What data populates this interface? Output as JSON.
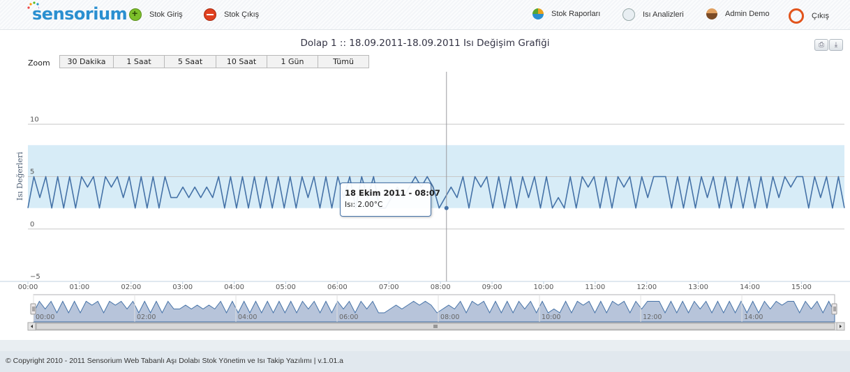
{
  "app": {
    "logo": "sensorium"
  },
  "nav": {
    "stock_in": "Stok Giriş",
    "stock_out": "Stok Çıkış",
    "stock_reports": "Stok Raporları",
    "heat_analysis": "Isı Analizleri",
    "user": "Admin Demo",
    "logout": "Çıkış"
  },
  "icons": [
    "plus-icon",
    "minus-icon",
    "pie-chart-icon",
    "chart-icon",
    "user-icon",
    "power-icon",
    "print-icon",
    "download-icon"
  ],
  "chart_title": "Dolap 1 :: 18.09.2011-18.09.2011 Isı Değişim Grafiği",
  "zoom": {
    "label": "Zoom",
    "buttons": [
      "30 Dakika",
      "1 Saat",
      "5 Saat",
      "10 Saat",
      "1 Gün",
      "Tümü"
    ]
  },
  "tooltip": {
    "title": "18 Ekim 2011 - 08:07",
    "value": "Isı: 2.00°C"
  },
  "footer": {
    "text": "© Copyright 2010 - 2011 Sensorium Web Tabanlı Aşı Dolabı Stok Yönetim ve Isı Takip Yazılımı | v.1.01.a"
  },
  "colors": {
    "series": "#4572a7",
    "band": "#d7ecf7",
    "navigator_fill": "#b7c4da",
    "logo": "#2a8fd0"
  },
  "chart_data": {
    "type": "line",
    "title": "Dolap 1 :: 18.09.2011-18.09.2011 Isı Değişim Grafiği",
    "ylabel": "Isı Değerleri",
    "xlabel": "",
    "ylim": [
      -5,
      15
    ],
    "yticks": [
      -5,
      0,
      5,
      10
    ],
    "xlim": [
      "00:00",
      "15:50"
    ],
    "x_ticks": [
      "00:00",
      "01:00",
      "02:00",
      "03:00",
      "04:00",
      "05:00",
      "06:00",
      "07:00",
      "08:00",
      "09:00",
      "10:00",
      "11:00",
      "12:00",
      "13:00",
      "14:00",
      "15:00"
    ],
    "navigator_ticks": [
      "00:00",
      "02:00",
      "04:00",
      "06:00",
      "08:00",
      "10:00",
      "12:00",
      "14:00"
    ],
    "plot_band": [
      2,
      8
    ],
    "crosshair_time": "08:07",
    "series": [
      {
        "color": "#4572a7",
        "values": [
          2,
          5,
          3,
          5,
          2,
          5,
          2,
          5,
          2,
          5,
          4,
          5,
          2,
          5,
          4,
          5,
          3,
          5,
          2,
          5,
          2,
          5,
          2,
          5,
          3,
          3,
          4,
          3,
          4,
          3,
          4,
          3,
          5,
          2,
          5,
          2,
          5,
          2,
          5,
          2,
          5,
          2,
          5,
          2,
          5,
          2,
          5,
          3,
          5,
          2,
          5,
          2,
          5,
          3,
          5,
          2,
          5,
          3,
          5,
          2,
          2,
          3,
          4,
          3,
          4,
          5,
          4,
          5,
          4,
          2,
          3,
          4,
          3,
          5,
          2,
          5,
          4,
          5,
          2,
          5,
          2,
          5,
          2,
          5,
          3,
          5,
          2,
          5,
          2,
          3,
          2,
          5,
          2,
          5,
          4,
          5,
          2,
          5,
          2,
          5,
          4,
          5,
          2,
          5,
          3,
          5,
          5,
          5,
          2,
          5,
          2,
          5,
          2,
          5,
          3,
          5,
          2,
          5,
          2,
          5,
          2,
          5,
          2,
          5,
          2,
          5,
          3,
          5,
          4,
          5,
          5,
          2,
          5,
          3,
          5,
          2,
          5,
          2
        ]
      }
    ]
  }
}
